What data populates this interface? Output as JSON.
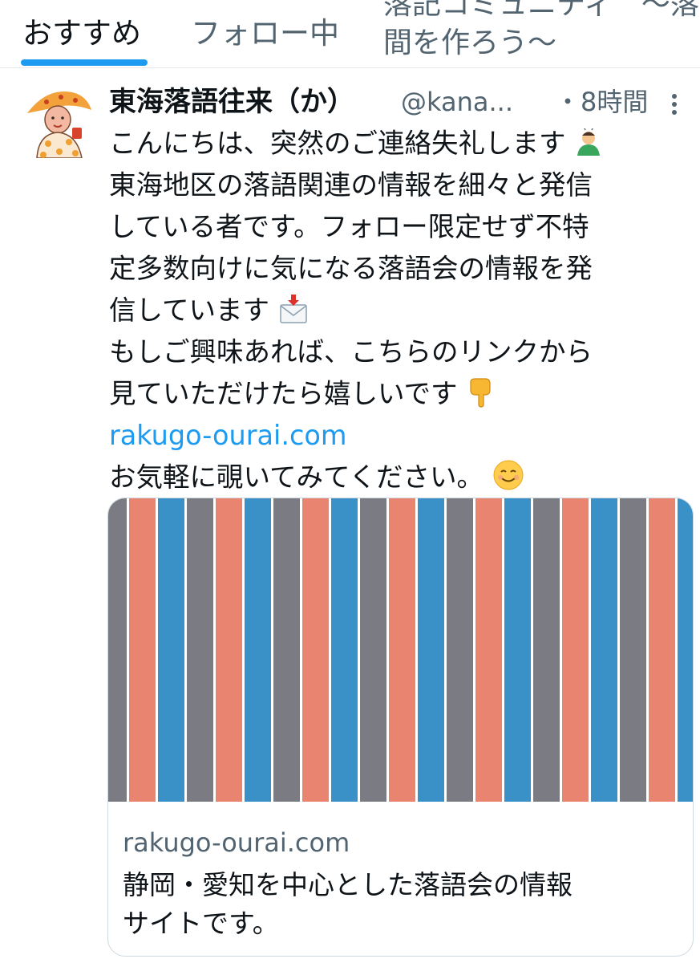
{
  "tabs": {
    "items": [
      {
        "label": "おすすめ",
        "active": true
      },
      {
        "label": "フォロー中",
        "active": false
      }
    ],
    "community_tab": {
      "line1": "落記コミュニティ　〜落",
      "line2": "間を作ろう〜"
    }
  },
  "tweet": {
    "author_name": "東海落語往来（か）",
    "handle": "@kana...",
    "time": "・8時間",
    "lines": [
      "こんにちは、突然のご連絡失礼します",
      "東海地区の落語関連の情報を細々と発信",
      "している者です。フォロー限定せず不特",
      "定多数向けに気になる落語会の情報を発",
      "信しています",
      "もしご興味あれば、こちらのリンクから",
      "見ていただけたら嬉しいです"
    ],
    "link": "rakugo-ourai.com",
    "closing": "お気軽に覗いてみてください。",
    "emojis": {
      "line1": "man-bowing-emoji",
      "line5": "envelope-arrow-emoji",
      "line7": "pointing-down-emoji",
      "closing": "smiling-face-emoji"
    }
  },
  "card": {
    "domain": "rakugo-ourai.com",
    "title_line1": "静岡・愛知を中心とした落語会の情報",
    "title_line2": "サイトです。",
    "stripe_colors": [
      "#7b7b84",
      "#e98470",
      "#3a91c7"
    ]
  },
  "colors": {
    "accent": "#1d9bf0",
    "secondary_text": "#536471",
    "text": "#0f1419"
  }
}
